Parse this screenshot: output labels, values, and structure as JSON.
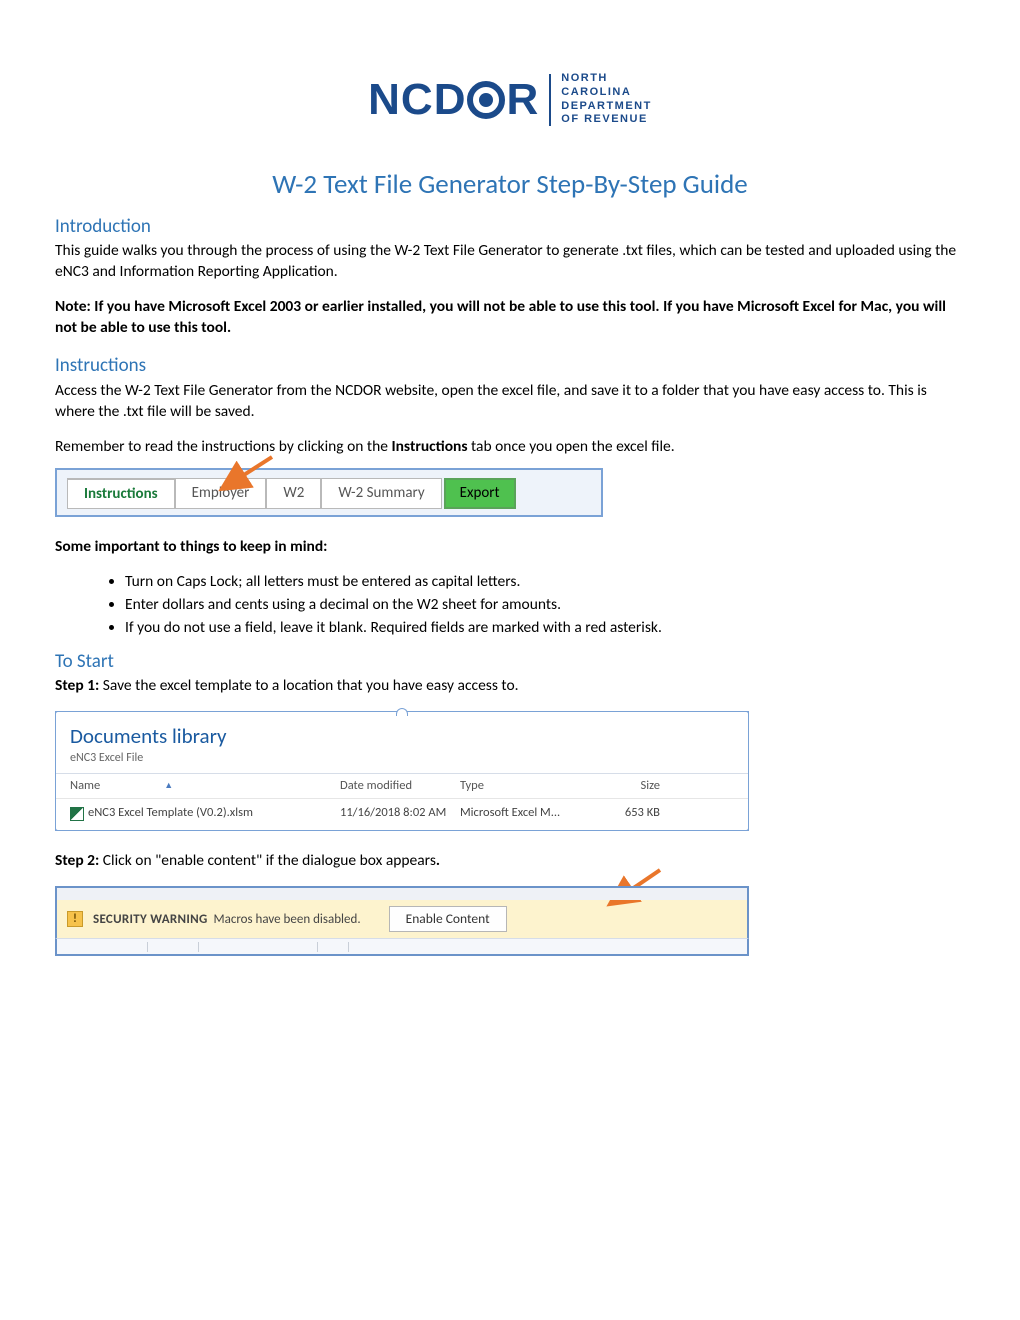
{
  "logo": {
    "main_prefix": "NCD",
    "main_suffix": "R",
    "sub_line1": "NORTH",
    "sub_line2": "CAROLINA",
    "sub_line3": "DEPARTMENT",
    "sub_line4": "OF REVENUE"
  },
  "title": "W-2 Text File Generator Step-By-Step Guide",
  "intro": {
    "heading": "Introduction",
    "paragraph": "This guide walks you through the process of using the W-2 Text File Generator to generate .txt files, which can be tested and uploaded using the eNC3 and Information Reporting Application.",
    "note": "Note: If you have Microsoft Excel 2003 or earlier installed, you will not be able to use this tool. If you have Microsoft Excel for Mac, you will not be able to use this tool."
  },
  "instructions": {
    "heading": "Instructions",
    "paragraph1": "Access the W-2 Text File Generator from the NCDOR website, open the excel file, and save it to a folder that you have easy access to. This is where the .txt file will be saved.",
    "paragraph2_pre": "Remember to read the instructions by clicking on the ",
    "paragraph2_bold": "Instructions",
    "paragraph2_post": " tab once you open the excel file.",
    "tabs": {
      "instructions": "Instructions",
      "employer": "Employer",
      "w2": "W2",
      "summary": "W-2 Summary",
      "export": "Export"
    },
    "keep_in_mind_heading": "Some important to things to keep in mind:",
    "bullets": [
      "Turn on Caps Lock; all letters must be entered as capital letters.",
      "Enter dollars and cents using a decimal on the W2 sheet for amounts.",
      "If you do not use a field, leave it blank. Required fields are marked with a red asterisk."
    ]
  },
  "tostart": {
    "heading": "To Start",
    "step1_label": "Step 1:",
    "step1_text": " Save the excel template to a location that you have easy access to.",
    "library": {
      "title": "Documents library",
      "subtitle": "eNC3 Excel File",
      "cols": {
        "name": "Name",
        "date": "Date modified",
        "type": "Type",
        "size": "Size"
      },
      "row": {
        "name": "eNC3 Excel Template (V0.2).xlsm",
        "date": "11/16/2018 8:02 AM",
        "type": "Microsoft Excel M...",
        "size": "653 KB"
      }
    },
    "step2_label": "Step 2:",
    "step2_text_pre": " Click on \"enable content\" if the dialogue box appears",
    "step2_dot": ".",
    "security": {
      "warning_label": "SECURITY WARNING",
      "warning_text": "Macros have been disabled.",
      "button": "Enable Content"
    }
  }
}
